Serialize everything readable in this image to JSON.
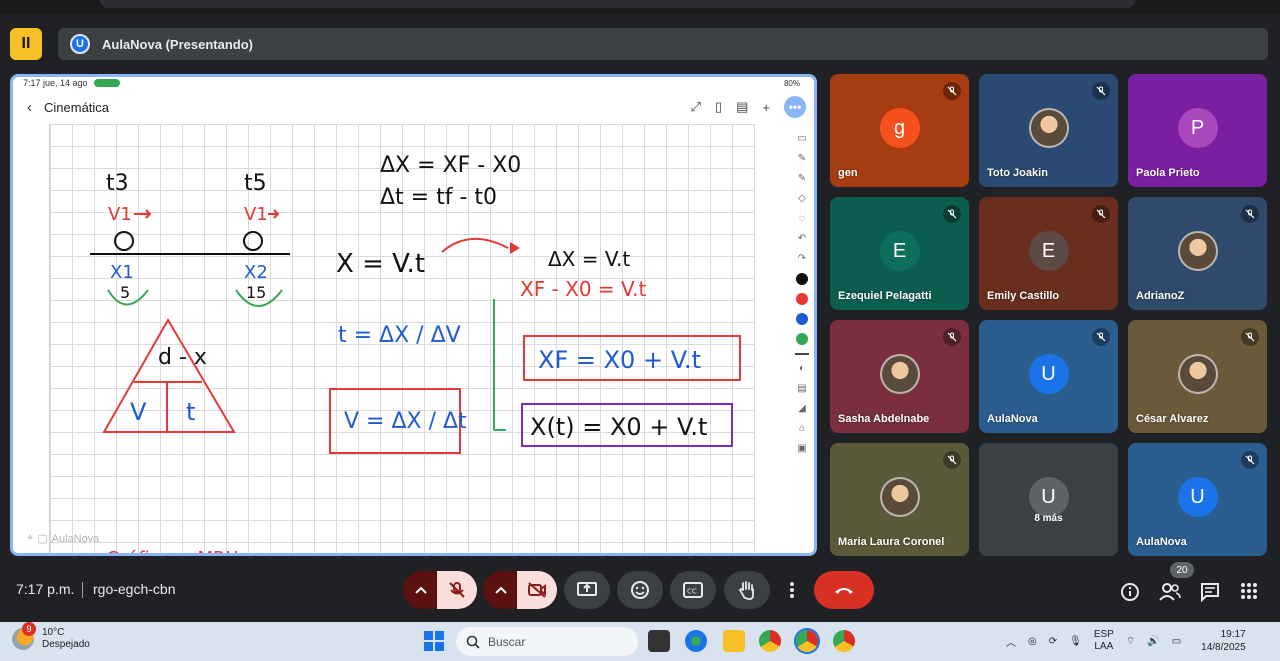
{
  "meeting": {
    "brand_badge": "II",
    "presenting_logo": "U",
    "presenting_title": "AulaNova (Presentando)"
  },
  "shared_screen": {
    "status_time": "7:17  jue, 14 ago",
    "status_battery": "80%",
    "note_title": "Cinemática",
    "watermark": "AulaNova",
    "toolbar_colors": [
      "#111111",
      "#e53935",
      "#1e5ad6",
      "#34a853"
    ],
    "whiteboard": {
      "t3": "t3",
      "t5": "t5",
      "v1_a": "V1",
      "v1_b": "V1",
      "x1": "X1",
      "x2": "X2",
      "v5": "5",
      "v15": "15",
      "triangle_top": "d - x",
      "triangle_left": "V",
      "triangle_right": "t",
      "eq_dx": "ΔX = XF - X0",
      "eq_dt": "Δt = tf - t0",
      "eq_x_vt": "X = V.t",
      "eq_dx_vt": "ΔX = V.t",
      "eq_xf_x0": "XF - X0 = V.t",
      "eq_t": "t = ΔX / ΔV",
      "eq_v": "V = ΔX / Δt",
      "eq_xf": "XF = X0 + V.t",
      "eq_xt": "X(t) = X0 + V.t",
      "bottom_text": "Gráficos : MRU :"
    }
  },
  "participants": [
    {
      "name": "gen",
      "initial": "g",
      "bg": "#a63c12",
      "avatar_bg": "#f4511e",
      "muted": true
    },
    {
      "name": "Toto Joakin",
      "initial": "",
      "bg": "#2a4a73",
      "avatar_bg": "",
      "muted": true
    },
    {
      "name": "Paola Prieto",
      "initial": "P",
      "bg": "#7b1fa2",
      "avatar_bg": "#ab47bc",
      "muted": false
    },
    {
      "name": "Ezequiel Pelagatti",
      "initial": "E",
      "bg": "#0b5e4f",
      "avatar_bg": "#0d6e5c",
      "muted": true
    },
    {
      "name": "Emily Castillo",
      "initial": "E",
      "bg": "#6a2e1e",
      "avatar_bg": "#5b4a45",
      "muted": true
    },
    {
      "name": "AdrianoZ",
      "initial": "",
      "bg": "#2f4a6a",
      "avatar_bg": "",
      "muted": true
    },
    {
      "name": "Sasha Abdelnabe",
      "initial": "",
      "bg": "#7a2e3e",
      "avatar_bg": "",
      "muted": true
    },
    {
      "name": "AulaNova",
      "initial": "U",
      "bg": "#2c5d8f",
      "avatar_bg": "#1a73e8",
      "muted": true
    },
    {
      "name": "César Alvarez",
      "initial": "",
      "bg": "#6b5a3a",
      "avatar_bg": "",
      "muted": true
    },
    {
      "name": "Maria Laura Coronel",
      "initial": "",
      "bg": "#5a5a3a",
      "avatar_bg": "",
      "muted": true
    },
    {
      "name": "",
      "initial": "U",
      "bg": "#3c4043",
      "avatar_bg": "#5f6368",
      "muted": false,
      "more_label": "8 más"
    },
    {
      "name": "AulaNova",
      "initial": "U",
      "bg": "#2c5d8f",
      "avatar_bg": "#1a73e8",
      "muted": true
    }
  ],
  "bottom_bar": {
    "clock": "7:17 p.m.",
    "meeting_code": "rgo-egch-cbn",
    "people_count": "20"
  },
  "taskbar": {
    "alert_count": "9",
    "temperature": "10°C",
    "weather": "Despejado",
    "search_placeholder": "Buscar",
    "lang_1": "ESP",
    "lang_2": "LAA",
    "time": "19:17",
    "date": "14/8/2025"
  }
}
